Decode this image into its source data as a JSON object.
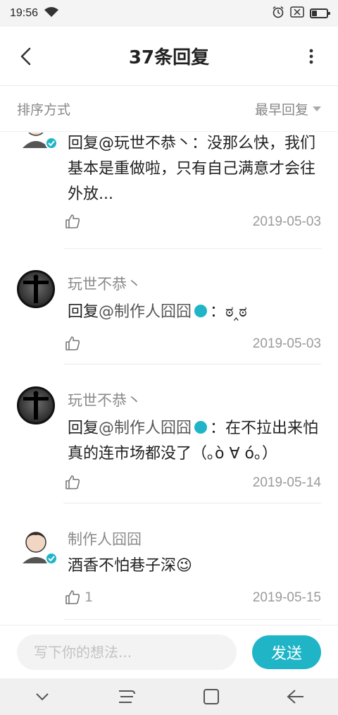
{
  "status_bar": {
    "time": "19:56",
    "icons": [
      "wifi-icon",
      "alarm-icon",
      "sim-off-icon",
      "battery-icon"
    ],
    "battery_level": 0.35
  },
  "header": {
    "title": "37条回复",
    "back_icon": "chevron-left-icon",
    "more_icon": "more-vertical-icon"
  },
  "sort_bar": {
    "label": "排序方式",
    "value": "最早回复"
  },
  "replies": [
    {
      "author": "",
      "text": "回复@玩世不恭丶：没那么快，我们基本是重做啦，只有自己满意才会往外放...",
      "mention": "@玩世不恭丶",
      "likes": "",
      "date": "2019-05-03"
    },
    {
      "author": "玩世不恭丶",
      "prefix": "回复",
      "mention": "@制作人囧囧",
      "suffix": "：ಠ‸ಠ",
      "likes": "",
      "date": "2019-05-03"
    },
    {
      "author": "玩世不恭丶",
      "prefix": "回复",
      "mention": "@制作人囧囧",
      "suffix": "：在不拉出来怕真的连市场都没了（｡ò ∀ ó｡）",
      "likes": "",
      "date": "2019-05-14"
    },
    {
      "author": "制作人囧囧",
      "text": "酒香不怕巷子深😉",
      "likes": "1",
      "date": "2019-05-15"
    }
  ],
  "composer": {
    "placeholder": "写下你的想法...",
    "send_label": "发送"
  },
  "colors": {
    "accent": "#1fb5c7",
    "text": "#222222",
    "muted": "#8a8a8a"
  }
}
